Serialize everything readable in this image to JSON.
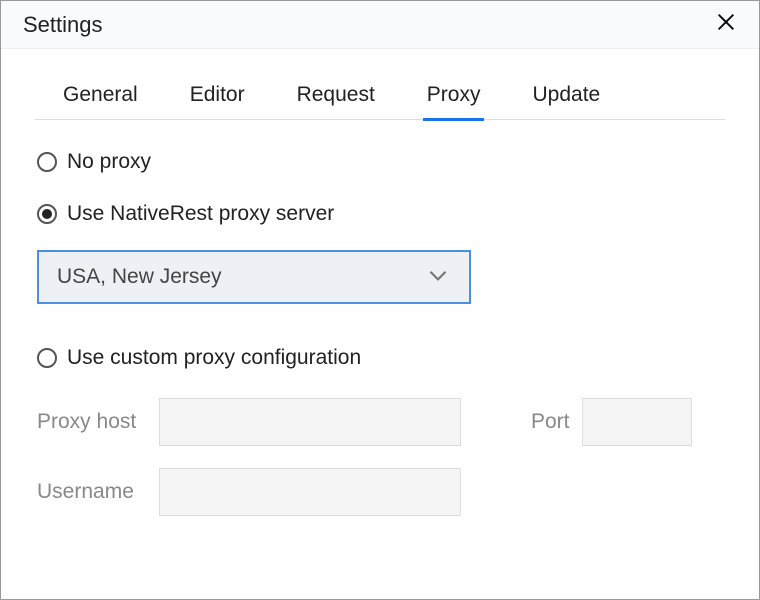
{
  "header": {
    "title": "Settings"
  },
  "tabs": [
    {
      "label": "General",
      "active": false
    },
    {
      "label": "Editor",
      "active": false
    },
    {
      "label": "Request",
      "active": false
    },
    {
      "label": "Proxy",
      "active": true
    },
    {
      "label": "Update",
      "active": false
    }
  ],
  "proxy": {
    "options": {
      "no_proxy": "No proxy",
      "nativerest": "Use NativeRest proxy server",
      "custom": "Use custom proxy configuration"
    },
    "selected": "nativerest",
    "server_select": {
      "value": "USA, New Jersey"
    },
    "labels": {
      "proxy_host": "Proxy host",
      "port": "Port",
      "username": "Username"
    },
    "fields": {
      "proxy_host": "",
      "port": "",
      "username": ""
    }
  }
}
